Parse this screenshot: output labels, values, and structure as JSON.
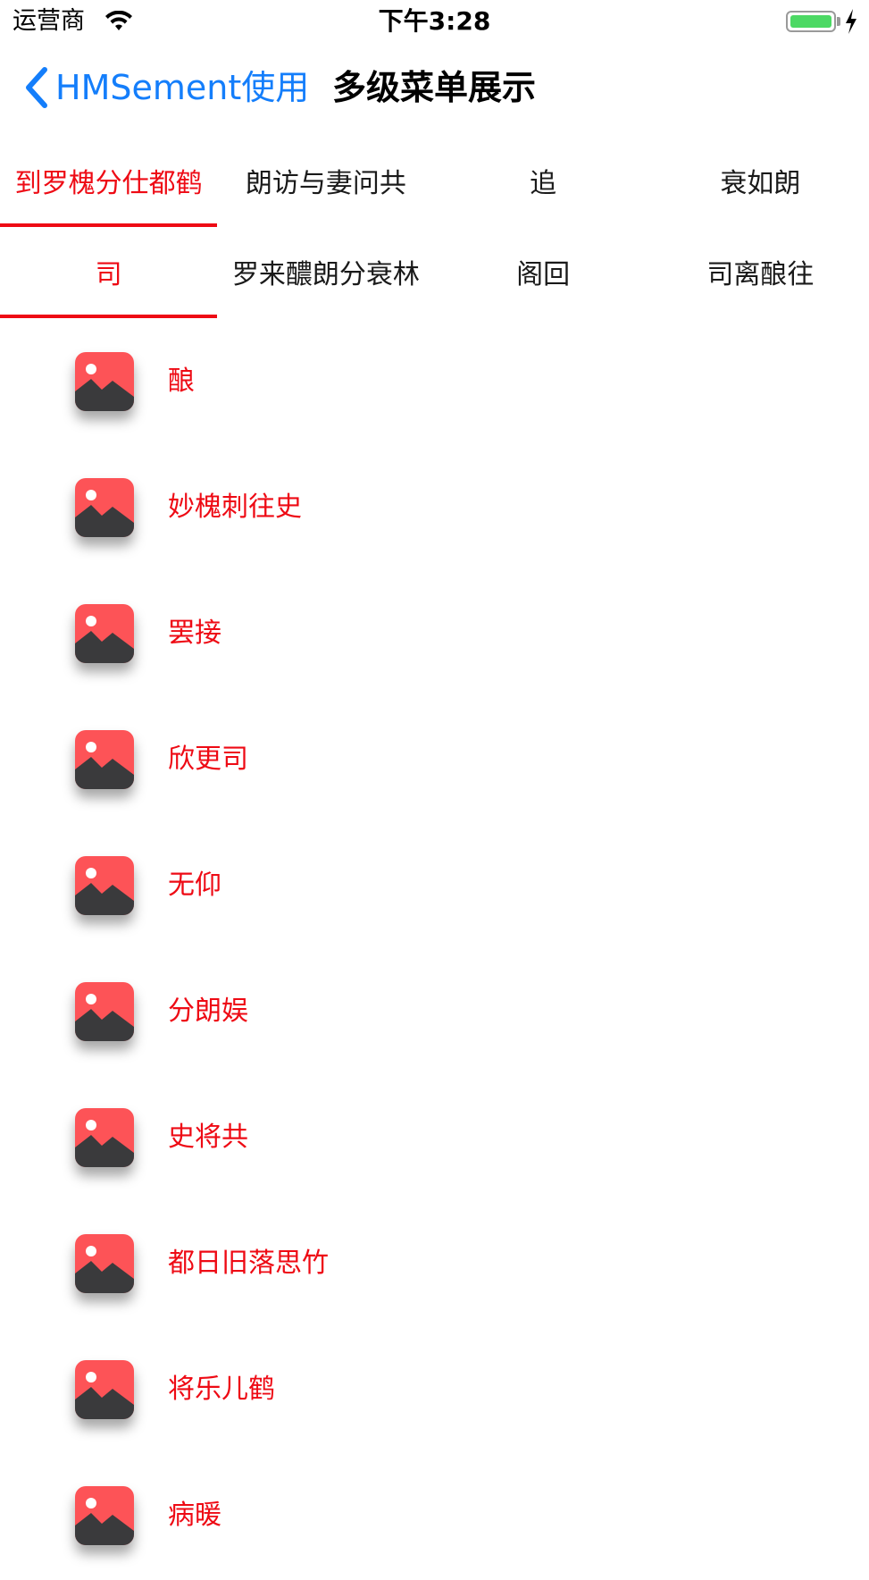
{
  "status_bar": {
    "carrier": "运营商",
    "time": "下午3:28",
    "battery_level": 1.0
  },
  "nav": {
    "back_label": "HMSement使用",
    "title": "多级菜单展示"
  },
  "segments_level1": {
    "selected_index": 0,
    "items": [
      {
        "label": "到罗槐分仕都鹤"
      },
      {
        "label": "朗访与妻问共"
      },
      {
        "label": "追"
      },
      {
        "label": "衰如朗"
      }
    ]
  },
  "segments_level2": {
    "selected_index": 0,
    "items": [
      {
        "label": "司"
      },
      {
        "label": "罗来醲朗分衰林"
      },
      {
        "label": "阁回"
      },
      {
        "label": "司离酿往"
      }
    ]
  },
  "list": {
    "items": [
      {
        "label": "酿"
      },
      {
        "label": "妙槐刺往史"
      },
      {
        "label": "罢接"
      },
      {
        "label": "欣更司"
      },
      {
        "label": "无仰"
      },
      {
        "label": "分朗娱"
      },
      {
        "label": "史将共"
      },
      {
        "label": "都日旧落思竹"
      },
      {
        "label": "将乐儿鹤"
      },
      {
        "label": "病暖"
      }
    ],
    "icon": "image-placeholder-icon"
  },
  "colors": {
    "accent": "#ee0a14",
    "link": "#147efb",
    "icon_bg": "#fd5357",
    "icon_mountain": "#3a3a3c",
    "battery": "#4cd964"
  }
}
